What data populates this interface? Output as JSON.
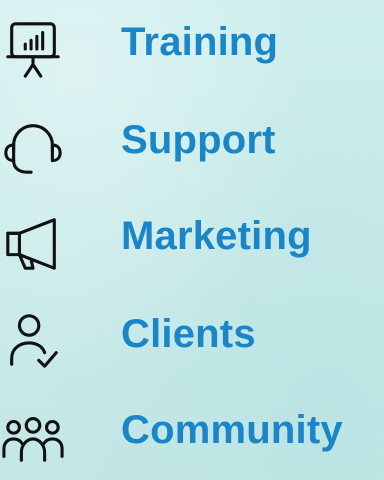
{
  "menu": {
    "items": [
      {
        "label": "Training",
        "icon": "presentation-chart-icon"
      },
      {
        "label": "Support",
        "icon": "headset-icon"
      },
      {
        "label": "Marketing",
        "icon": "megaphone-icon"
      },
      {
        "label": "Clients",
        "icon": "user-check-icon"
      },
      {
        "label": "Community",
        "icon": "group-icon"
      }
    ]
  },
  "colors": {
    "label": "#1a86c8",
    "icon": "#111111",
    "background": "#c9eae9"
  }
}
